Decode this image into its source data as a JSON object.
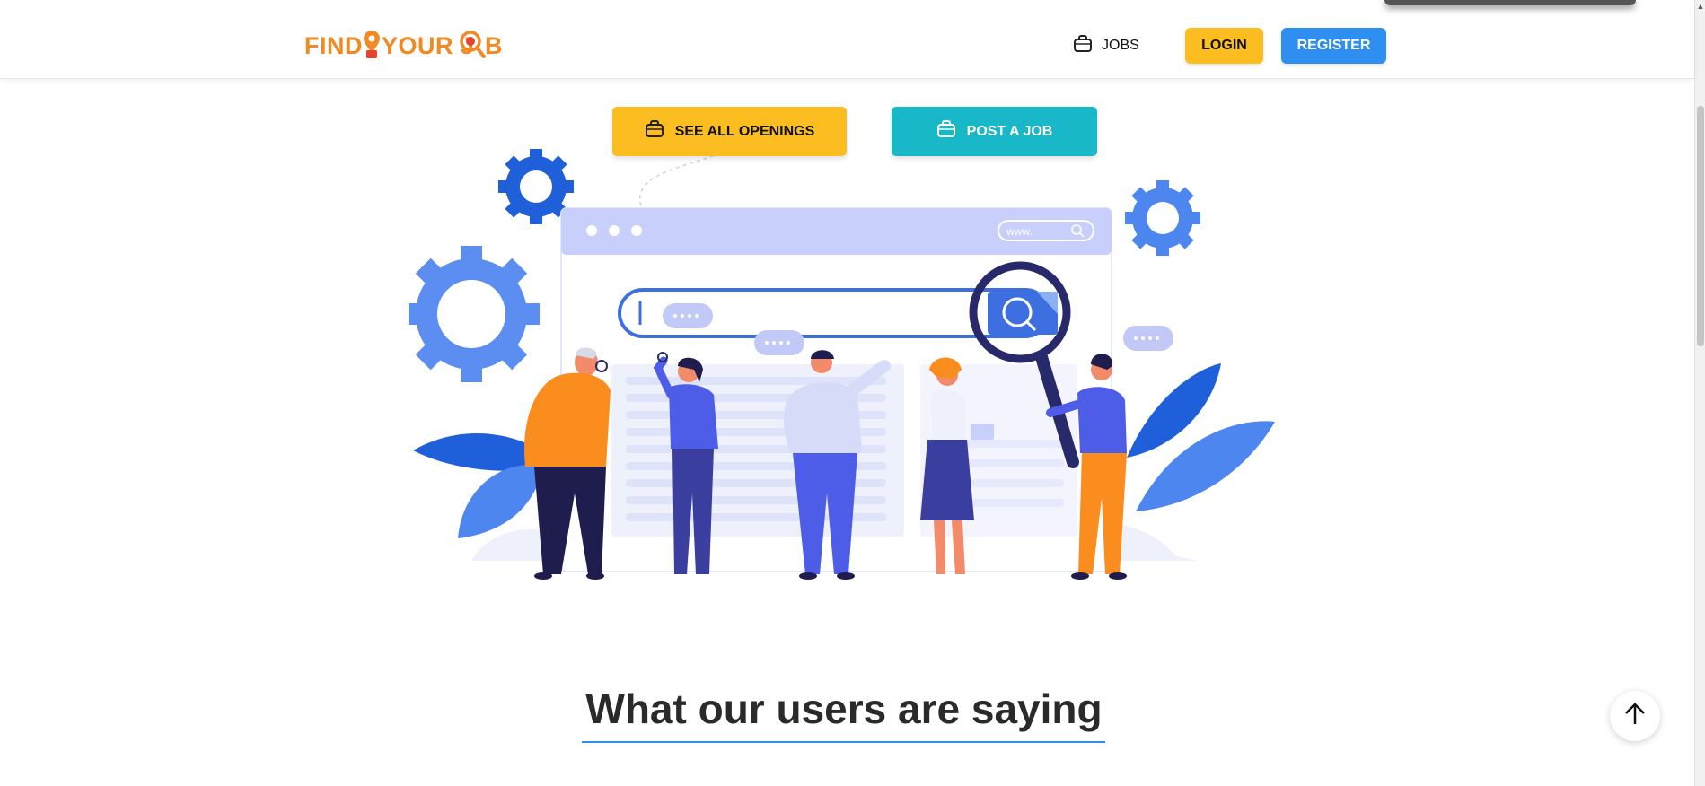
{
  "header": {
    "logo_text": "FINDYOURJOB",
    "nav_jobs_label": "JOBS",
    "login_label": "LOGIN",
    "register_label": "REGISTER"
  },
  "hero": {
    "see_all_openings_label": "SEE ALL OPENINGS",
    "post_job_label": "POST A JOB",
    "browser_url_text": "www."
  },
  "testimonials": {
    "title": "What our users are saying"
  },
  "icons": {
    "jobs": "briefcase-icon",
    "openings": "briefcase-icon",
    "post_job": "briefcase-icon",
    "scroll_top": "arrow-up-icon"
  },
  "colors": {
    "brand_orange": "#f08a24",
    "login_yellow": "#fbbd1f",
    "register_blue": "#2f8ff0",
    "post_teal": "#19b8c9",
    "heading": "#2a2a2a"
  }
}
